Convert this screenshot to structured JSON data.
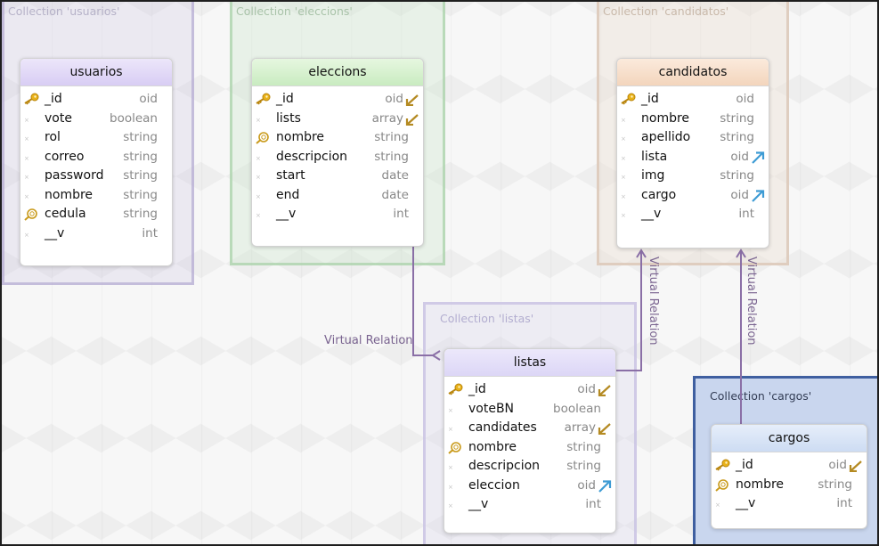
{
  "colors": {
    "relation_line": "#8a6fa6",
    "group_cargos_border": "#3f5fa0",
    "type_text": "#888888"
  },
  "groups": [
    {
      "id": "usuarios",
      "label": "Collection 'usuarios'"
    },
    {
      "id": "elecciones",
      "label": "Collection 'eleccions'"
    },
    {
      "id": "candidatos",
      "label": "Collection 'candidatos'"
    },
    {
      "id": "listas",
      "label": "Collection 'listas'"
    },
    {
      "id": "cargos",
      "label": "Collection 'cargos'"
    }
  ],
  "entities": {
    "usuarios": {
      "title": "usuarios",
      "fields": [
        {
          "name": "_id",
          "type": "oid",
          "icon": "primary-key-icon"
        },
        {
          "name": "vote",
          "type": "boolean"
        },
        {
          "name": "rol",
          "type": "string"
        },
        {
          "name": "correo",
          "type": "string"
        },
        {
          "name": "password",
          "type": "string"
        },
        {
          "name": "nombre",
          "type": "string"
        },
        {
          "name": "cedula",
          "type": "string",
          "icon": "index-icon"
        },
        {
          "name": "__v",
          "type": "int"
        }
      ]
    },
    "elecciones": {
      "title": "eleccions",
      "fields": [
        {
          "name": "_id",
          "type": "oid",
          "icon": "primary-key-icon",
          "relation": "incoming-arrow-icon"
        },
        {
          "name": "lists",
          "type": "array",
          "relation": "incoming-arrow-icon"
        },
        {
          "name": "nombre",
          "type": "string",
          "icon": "index-icon"
        },
        {
          "name": "descripcion",
          "type": "string"
        },
        {
          "name": "start",
          "type": "date"
        },
        {
          "name": "end",
          "type": "date"
        },
        {
          "name": "__v",
          "type": "int"
        }
      ]
    },
    "candidatos": {
      "title": "candidatos",
      "fields": [
        {
          "name": "_id",
          "type": "oid",
          "icon": "primary-key-icon"
        },
        {
          "name": "nombre",
          "type": "string"
        },
        {
          "name": "apellido",
          "type": "string"
        },
        {
          "name": "lista",
          "type": "oid",
          "relation": "outgoing-arrow-icon"
        },
        {
          "name": "img",
          "type": "string"
        },
        {
          "name": "cargo",
          "type": "oid",
          "relation": "outgoing-arrow-icon"
        },
        {
          "name": "__v",
          "type": "int"
        }
      ]
    },
    "listas": {
      "title": "listas",
      "fields": [
        {
          "name": "_id",
          "type": "oid",
          "icon": "primary-key-icon",
          "relation": "incoming-arrow-icon"
        },
        {
          "name": "voteBN",
          "type": "boolean"
        },
        {
          "name": "candidates",
          "type": "array",
          "relation": "incoming-arrow-icon"
        },
        {
          "name": "nombre",
          "type": "string",
          "icon": "index-icon"
        },
        {
          "name": "descripcion",
          "type": "string"
        },
        {
          "name": "eleccion",
          "type": "oid",
          "relation": "outgoing-arrow-icon"
        },
        {
          "name": "__v",
          "type": "int"
        }
      ]
    },
    "cargos": {
      "title": "cargos",
      "fields": [
        {
          "name": "_id",
          "type": "oid",
          "icon": "primary-key-icon",
          "relation": "incoming-arrow-icon"
        },
        {
          "name": "nombre",
          "type": "string",
          "icon": "index-icon"
        },
        {
          "name": "__v",
          "type": "int"
        }
      ]
    }
  },
  "relations": [
    {
      "from": "listas.eleccion",
      "to": "eleccions",
      "label": "Virtual Relation"
    },
    {
      "from": "candidatos.lista",
      "to": "listas",
      "label": "Virtual Relation"
    },
    {
      "from": "candidatos.cargo",
      "to": "cargos",
      "label": "Virtual Relation"
    }
  ]
}
